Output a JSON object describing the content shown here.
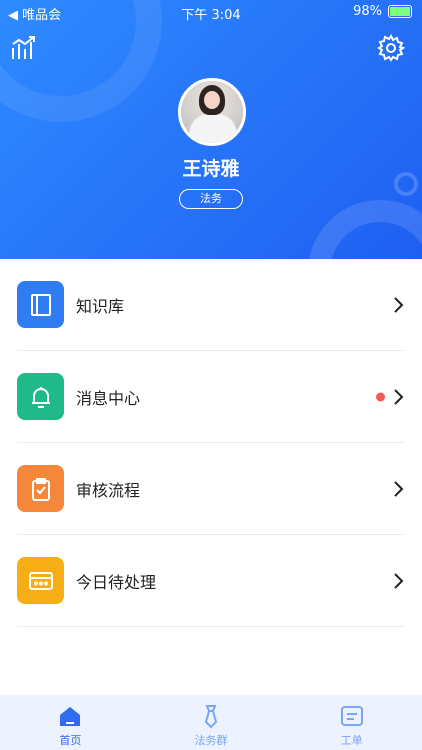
{
  "status_bar": {
    "back_app": "◀ 唯品会",
    "time": "下午 3:04",
    "battery": "98%"
  },
  "profile": {
    "name": "王诗雅",
    "role": "法务"
  },
  "menu": {
    "items": [
      {
        "label": "知识库",
        "icon": "book-icon",
        "color": "#2f7df2"
      },
      {
        "label": "消息中心",
        "icon": "bell-icon",
        "color": "#20b98a",
        "has_dot": true
      },
      {
        "label": "审核流程",
        "icon": "clipboard-check-icon",
        "color": "#f5873a"
      },
      {
        "label": "今日待处理",
        "icon": "card-icon",
        "color": "#f6ae14"
      }
    ]
  },
  "tabbar": {
    "tabs": [
      {
        "label": "首页",
        "icon": "home-icon",
        "active": true
      },
      {
        "label": "法务群",
        "icon": "tie-icon",
        "active": false
      },
      {
        "label": "工单",
        "icon": "ticket-icon",
        "active": false
      }
    ],
    "active_color": "#2f6cf0",
    "inactive_color": "#7aa6f5"
  }
}
